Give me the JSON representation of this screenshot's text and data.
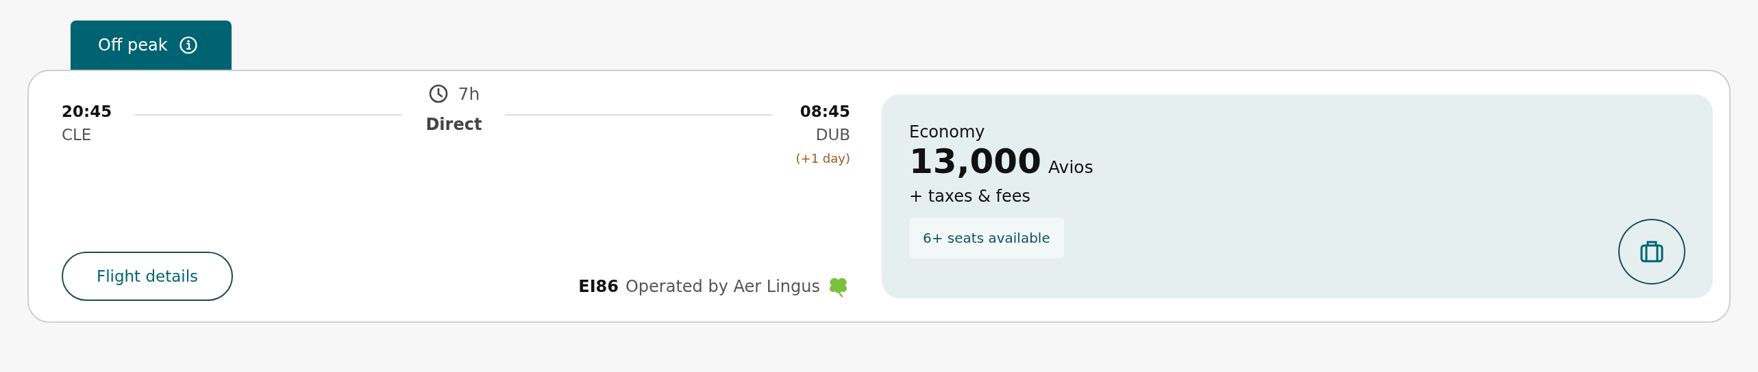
{
  "fare_tab": {
    "label": "Off peak",
    "selected": true
  },
  "flight": {
    "departure": {
      "time": "20:45",
      "airport": "CLE"
    },
    "duration": "7h",
    "stops": "Direct",
    "arrival": {
      "time": "08:45",
      "airport": "DUB",
      "day_offset": "(+1 day)"
    },
    "details_button": "Flight details",
    "flight_number": "EI86",
    "operator": "Operated by Aer Lingus"
  },
  "fare": {
    "cabin": "Economy",
    "price": "13,000",
    "currency": "Avios",
    "extras": "+ taxes & fees",
    "availability": "6+ seats available"
  }
}
